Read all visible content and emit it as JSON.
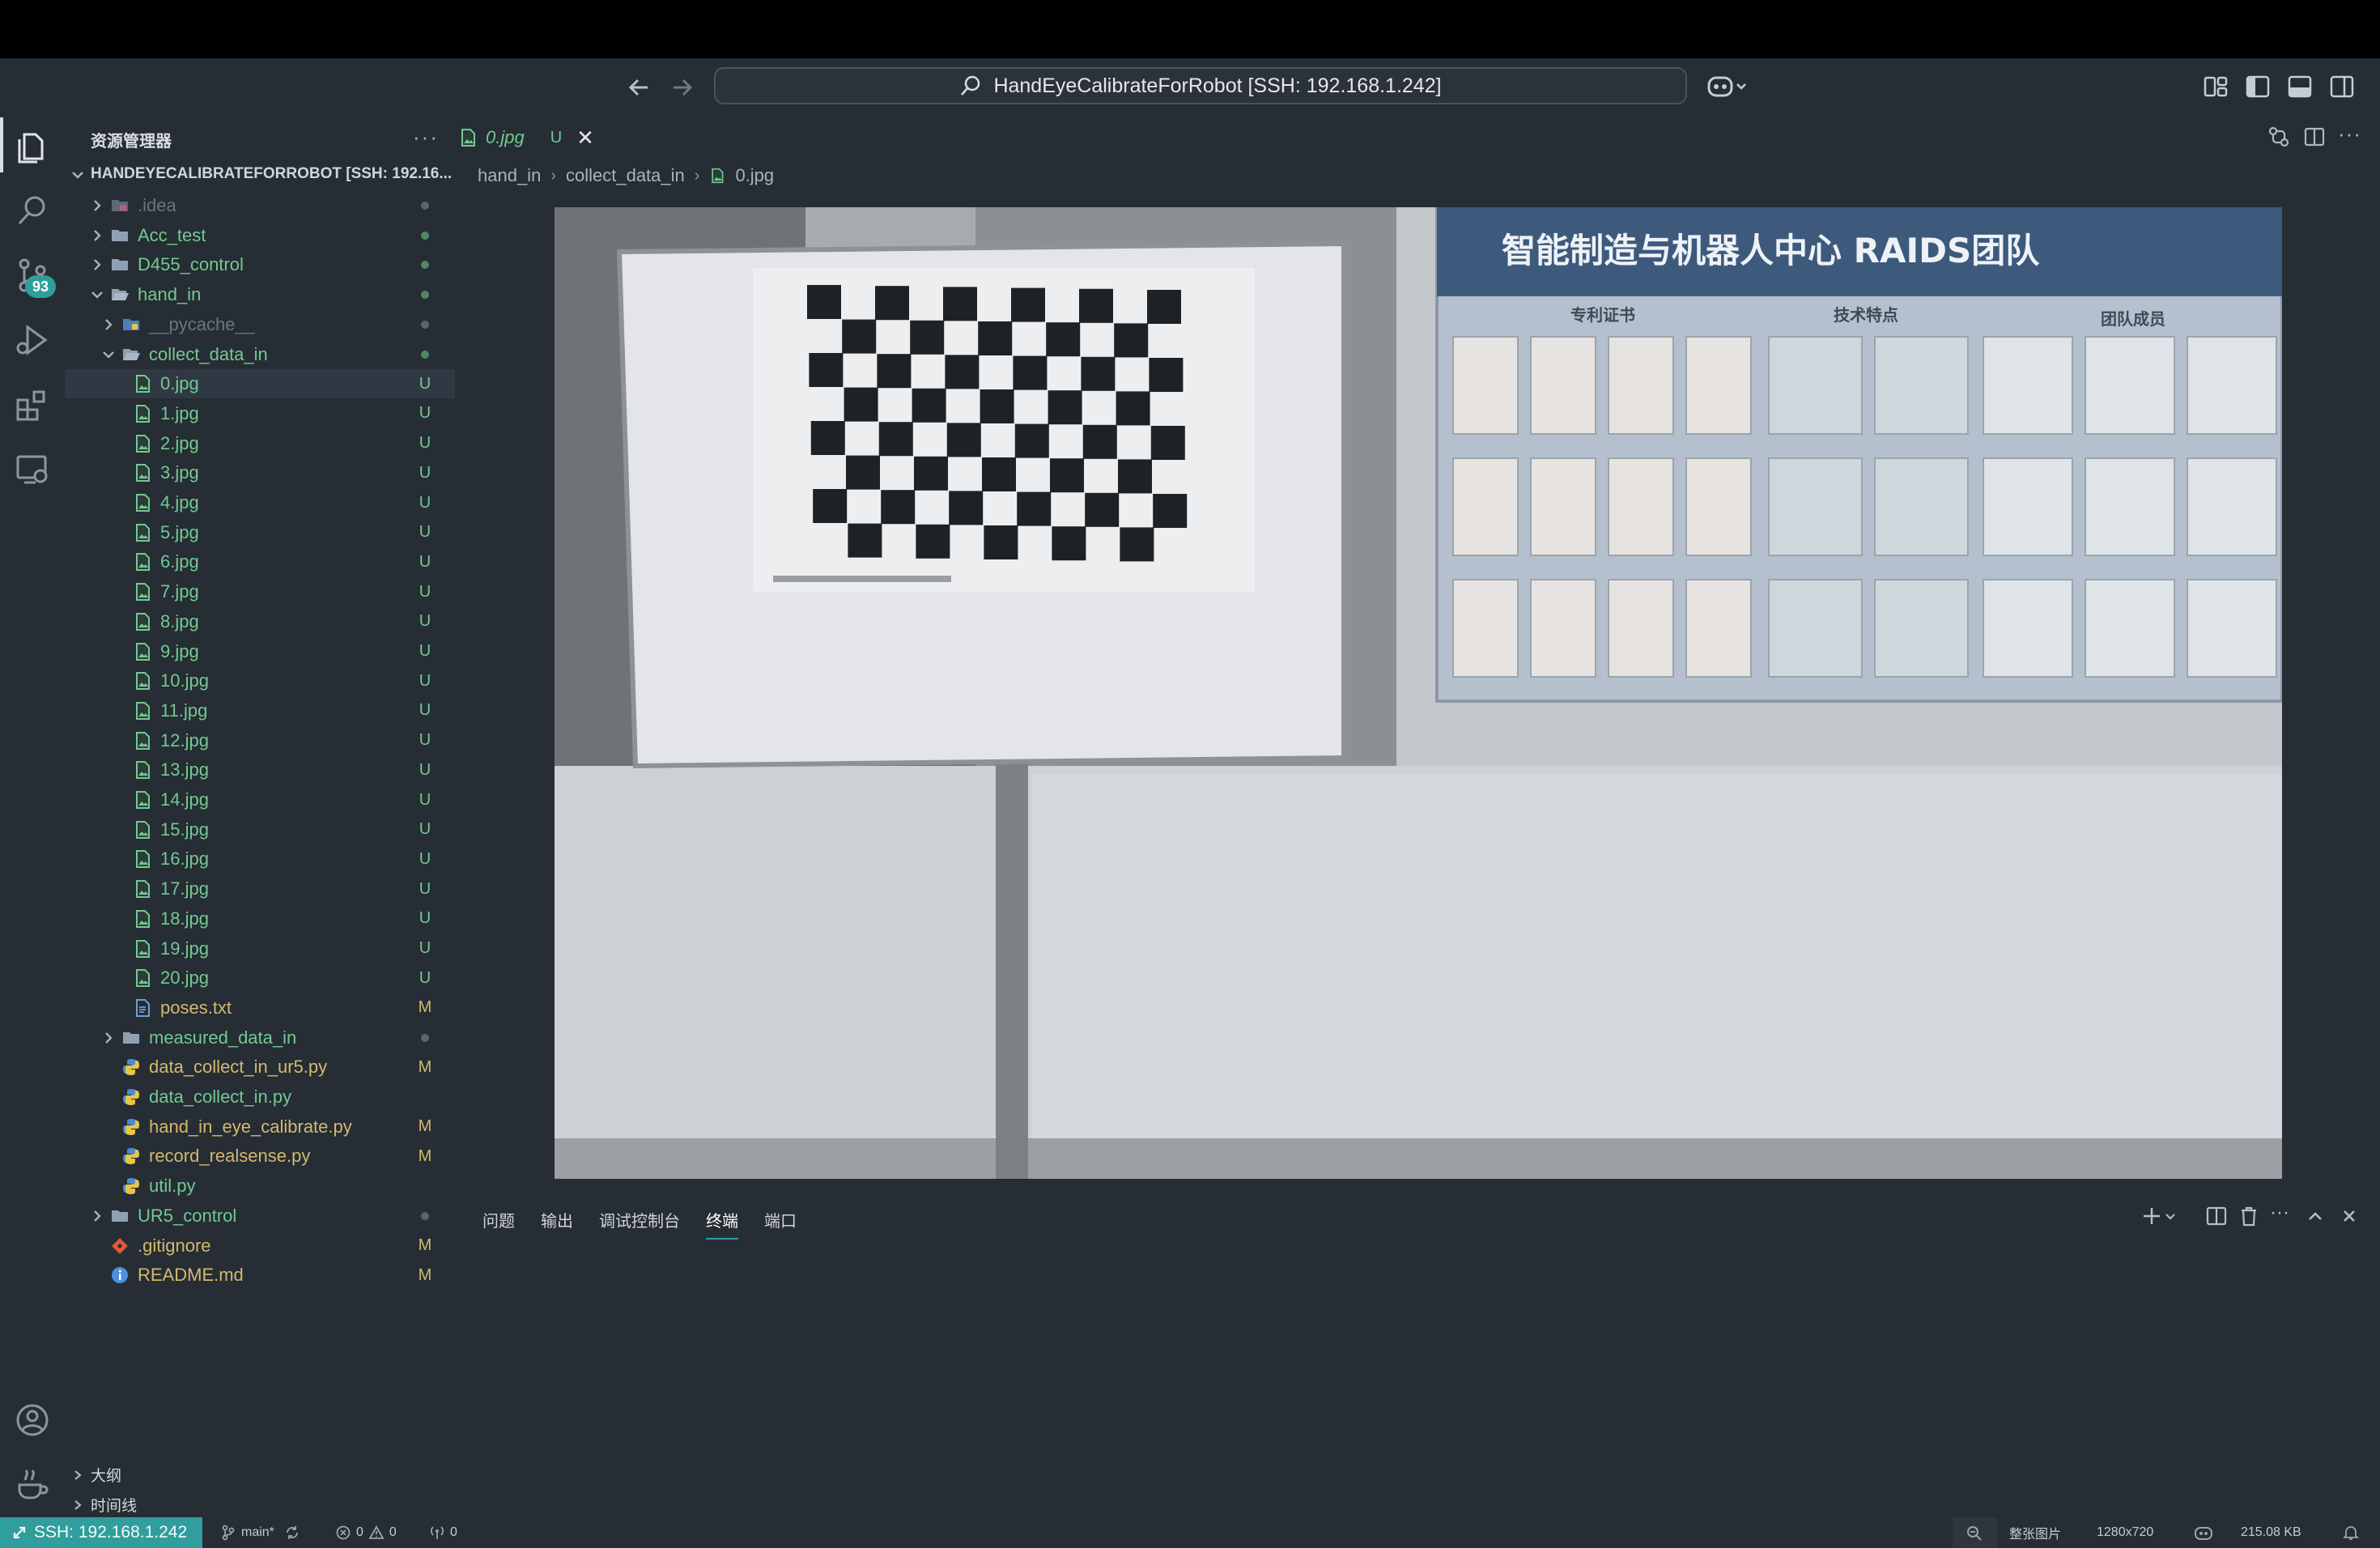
{
  "window": {
    "command_center": "HandEyeCalibrateForRobot [SSH: 192.168.1.242]"
  },
  "activity_bar": {
    "scm_badge": "93"
  },
  "sidebar": {
    "title": "资源管理器",
    "more": "···",
    "root": "HANDEYECALIBRATEFORROBOT [SSH: 192.16...",
    "items": [
      {
        "name": ".idea",
        "badge": ""
      },
      {
        "name": "Acc_test",
        "badge": ""
      },
      {
        "name": "D455_control",
        "badge": ""
      },
      {
        "name": "hand_in",
        "badge": ""
      },
      {
        "name": "__pycache__",
        "badge": ""
      },
      {
        "name": "collect_data_in",
        "badge": ""
      },
      {
        "name": "0.jpg",
        "badge": "U"
      },
      {
        "name": "1.jpg",
        "badge": "U"
      },
      {
        "name": "2.jpg",
        "badge": "U"
      },
      {
        "name": "3.jpg",
        "badge": "U"
      },
      {
        "name": "4.jpg",
        "badge": "U"
      },
      {
        "name": "5.jpg",
        "badge": "U"
      },
      {
        "name": "6.jpg",
        "badge": "U"
      },
      {
        "name": "7.jpg",
        "badge": "U"
      },
      {
        "name": "8.jpg",
        "badge": "U"
      },
      {
        "name": "9.jpg",
        "badge": "U"
      },
      {
        "name": "10.jpg",
        "badge": "U"
      },
      {
        "name": "11.jpg",
        "badge": "U"
      },
      {
        "name": "12.jpg",
        "badge": "U"
      },
      {
        "name": "13.jpg",
        "badge": "U"
      },
      {
        "name": "14.jpg",
        "badge": "U"
      },
      {
        "name": "15.jpg",
        "badge": "U"
      },
      {
        "name": "16.jpg",
        "badge": "U"
      },
      {
        "name": "17.jpg",
        "badge": "U"
      },
      {
        "name": "18.jpg",
        "badge": "U"
      },
      {
        "name": "19.jpg",
        "badge": "U"
      },
      {
        "name": "20.jpg",
        "badge": "U"
      },
      {
        "name": "poses.txt",
        "badge": "M"
      },
      {
        "name": "measured_data_in",
        "badge": ""
      },
      {
        "name": "data_collect_in_ur5.py",
        "badge": "M"
      },
      {
        "name": "data_collect_in.py",
        "badge": ""
      },
      {
        "name": "hand_in_eye_calibrate.py",
        "badge": "M"
      },
      {
        "name": "record_realsense.py",
        "badge": "M"
      },
      {
        "name": "util.py",
        "badge": ""
      },
      {
        "name": "UR5_control",
        "badge": ""
      },
      {
        "name": ".gitignore",
        "badge": "M"
      },
      {
        "name": "README.md",
        "badge": "M"
      }
    ],
    "outline": "大纲",
    "timeline": "时间线"
  },
  "editor": {
    "tab": {
      "label": "0.jpg",
      "status": "U",
      "close": "✕"
    },
    "breadcrumb": [
      "hand_in",
      "collect_data_in",
      "0.jpg"
    ],
    "image": {
      "poster_title": "智能制造与机器人中心  RAIDS团队",
      "poster_sections": [
        "专利证书",
        "技术特点",
        "团队成员"
      ]
    }
  },
  "panel": {
    "tabs": [
      "问题",
      "输出",
      "调试控制台",
      "终端",
      "端口"
    ],
    "active_tab": "终端"
  },
  "statusbar": {
    "remote": "SSH: 192.168.1.242",
    "branch": "main*",
    "errors": "0",
    "warnings": "0",
    "ports": "0",
    "zoom_mode": "整张图片",
    "dimensions": "1280x720",
    "file_size": "215.08 KB"
  },
  "colors": {
    "accent": "#2f9e9c",
    "untracked": "#73c991",
    "modified": "#d3b96e",
    "background": "#262d34"
  }
}
